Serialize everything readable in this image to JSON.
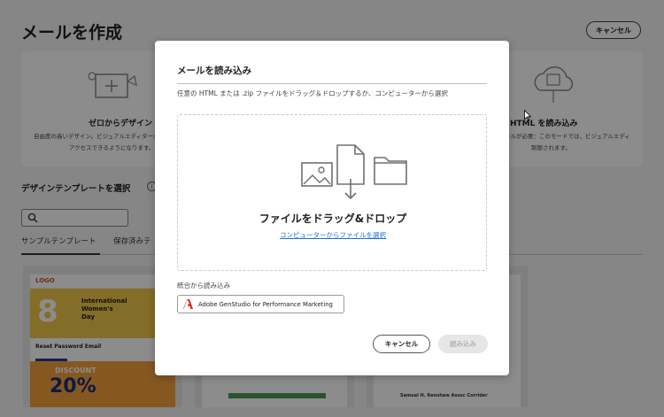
{
  "background": {
    "page_title": "メールを作成",
    "cancel_label": "キャンセル",
    "card_scratch": {
      "title": "ゼロからデザイン",
      "desc_line1": "自由度の高いデザイン。ビジュアルエディターの",
      "desc_line2": "アクセスできるようになります。"
    },
    "card_import": {
      "title": "HTML を読み込み",
      "desc_line1": "キルが必要：このモードでは、ビジュアルエディ",
      "desc_line2": "制限されます。"
    },
    "template_section_title": "デザインテンプレートを選択",
    "tabs": [
      "サンプルテンプレート",
      "保存済みテ"
    ],
    "thumbnail1": {
      "logo": "LOGO",
      "hero_number": "8",
      "hero_text_line1": "International",
      "hero_text_line2": "Women's",
      "hero_text_line3": "Day",
      "section_title": "Reset Password Email",
      "promo_text": "DISCOUNT",
      "promo_pct": "20%"
    },
    "thumbnail3": {
      "caption": "Samuel H. Renshaw Assoc Corrider"
    }
  },
  "modal": {
    "title": "メールを読み込み",
    "description": "任意の HTML または .zip ファイルをドラッグ＆ドロップするか、コンピューターから選択",
    "dropzone_title": "ファイルをドラッグ&ドロップ",
    "dropzone_link": "コンピューターからファイルを選択",
    "integration_label": "統合から読み込み",
    "integration_button": "Adobe GenStudio for Performance Marketing",
    "cancel_label": "キャンセル",
    "import_label": "読み込み"
  },
  "colors": {
    "link": "#1f6fd1",
    "adobe_red": "#e1251b",
    "overlay": "rgba(0,0,0,0.45)"
  },
  "icons": [
    "image-icon",
    "file-icon",
    "folder-icon",
    "down-arrow-icon",
    "adobe-logo-icon",
    "search-icon",
    "info-icon",
    "cursor-icon"
  ]
}
